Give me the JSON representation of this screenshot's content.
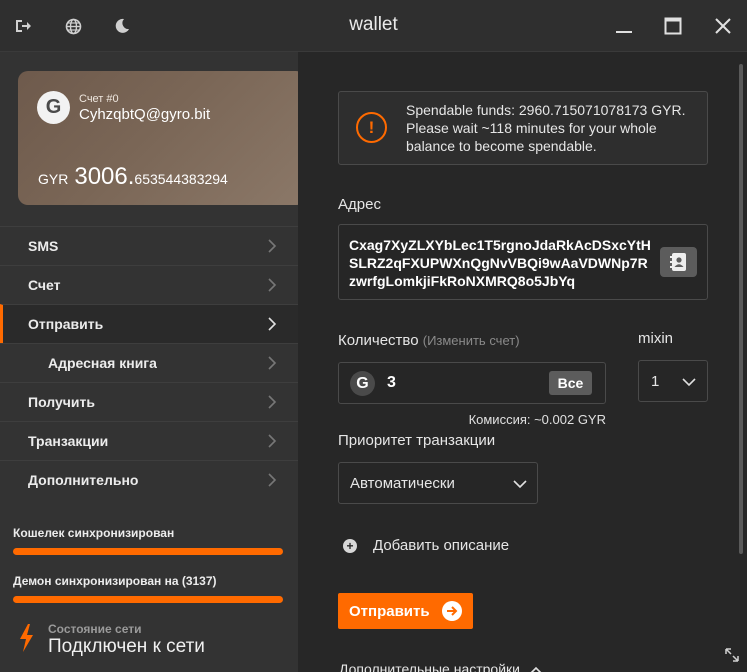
{
  "window": {
    "title": "wallet",
    "icons": [
      "logout-icon",
      "globe-icon",
      "moon-icon"
    ],
    "controls": [
      "minimize-icon",
      "maximize-icon",
      "close-icon"
    ]
  },
  "card": {
    "account_label": "Счет #0",
    "account_address": "CyhzqbtQ@gyro.bit",
    "currency": "GYR",
    "balance_int": "3006.",
    "balance_frac": "653544383294",
    "logo_letter": "G"
  },
  "menu": {
    "items": [
      {
        "label": "SMS"
      },
      {
        "label": "Счет"
      },
      {
        "label": "Отправить"
      },
      {
        "label": "Адресная книга"
      },
      {
        "label": "Получить"
      },
      {
        "label": "Транзакции"
      },
      {
        "label": "Дополнительно"
      }
    ]
  },
  "status": {
    "wallet_sync": "Кошелек синхронизирован",
    "daemon_sync": "Демон синхронизирован на (3137)",
    "network_label": "Состояние сети",
    "network_value": "Подключен к сети"
  },
  "alert": {
    "icon": "!",
    "text": "Spendable funds: 2960.715071078173 GYR. Please wait ~118 minutes for your whole balance to become spendable."
  },
  "form": {
    "address_label": "Адрес",
    "address_value": "Cxag7XyZLXYbLec1T5rgnoJdaRkAcDSxcYtHSLRZ2qFXUPWXnQgNvVBQi9wAaVDWNp7RzwrfgLomkjiFkRoNXMRQ8o5JbYq",
    "amount_label": "Количество",
    "amount_hint": "(Изменить счет)",
    "amount_value": "3",
    "amount_logo": "G",
    "all_button": "Все",
    "mixin_label": "mixin",
    "mixin_value": "1",
    "fee": "Комиссия: ~0.002 GYR",
    "priority_label": "Приоритет транзакции",
    "priority_value": "Автоматически",
    "add_description": "Добавить описание",
    "send_button": "Отправить",
    "advanced": "Дополнительные настройки"
  },
  "colors": {
    "accent": "#ff6a00",
    "sidebar_bg": "#333333",
    "main_bg": "#272727"
  }
}
